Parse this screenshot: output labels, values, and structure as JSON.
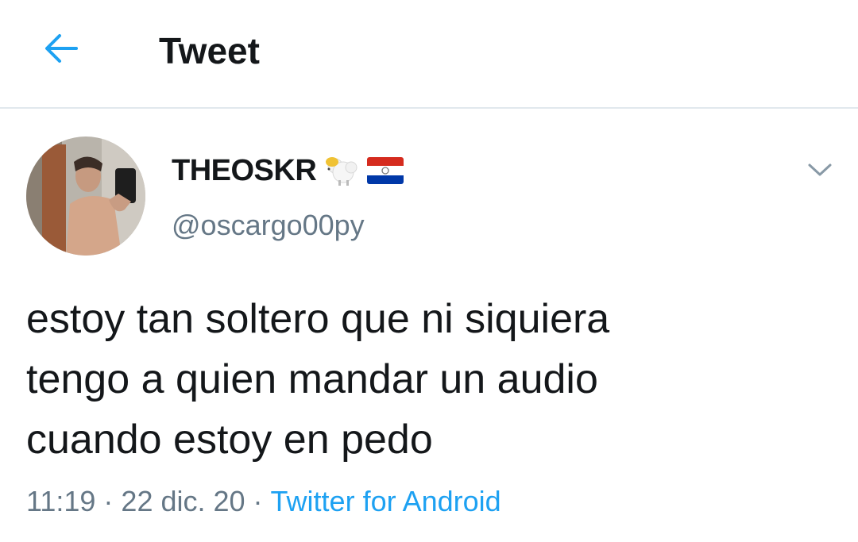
{
  "header": {
    "back_icon": "arrow-left-icon",
    "title": "Tweet"
  },
  "tweet": {
    "author": {
      "display_name": "THEOSKR",
      "emojis": [
        "sheep-emoji",
        "paraguay-flag-emoji"
      ],
      "handle": "@oscargo00py",
      "avatar": "avatar-photo"
    },
    "caret_icon": "chevron-down-icon",
    "text": "estoy tan soltero que ni siquiera\ntengo a quien mandar un audio\ncuando estoy en pedo",
    "time": "11:19",
    "separator": "·",
    "date": "22 dic. 20",
    "source": "Twitter for Android"
  },
  "colors": {
    "accent": "#1da1f2",
    "text_primary": "#14171a",
    "text_secondary": "#657786",
    "divider": "#e1e8ed"
  }
}
